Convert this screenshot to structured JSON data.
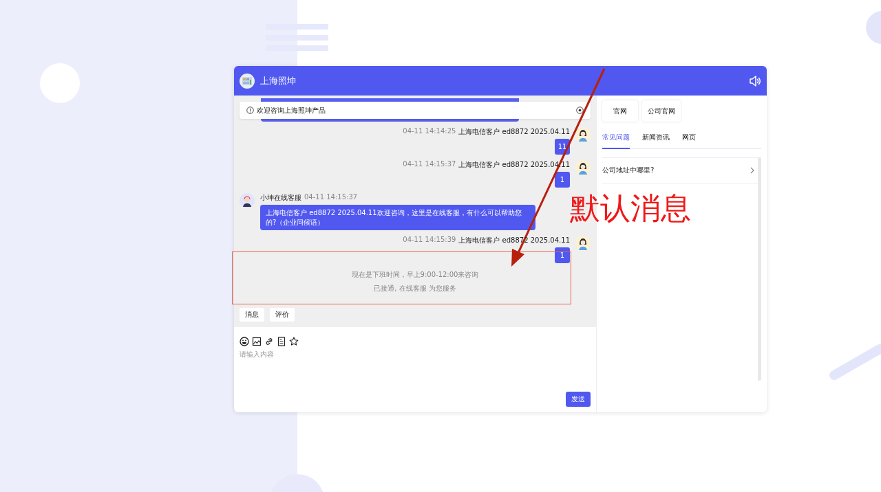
{
  "header": {
    "title": "上海照坤"
  },
  "notice": {
    "text": "欢迎咨询上海照坤产品"
  },
  "messages": [
    {
      "kind": "user",
      "time": "04-11 14:14:25",
      "sender": "上海电信客户 ed8872 2025.04.11",
      "text": "11"
    },
    {
      "kind": "user",
      "time": "04-11 14:15:37",
      "sender": "上海电信客户 ed8872 2025.04.11",
      "text": "1"
    },
    {
      "kind": "agent",
      "sender": "小坤在线客服",
      "time": "04-11 14:15:37",
      "text": "上海电信客户 ed8872 2025.04.11欢迎咨询，这里是在线客服，有什么可以帮助您的?（企业问候语）"
    },
    {
      "kind": "user",
      "time": "04-11 14:15:39",
      "sender": "上海电信客户 ed8872 2025.04.11",
      "text": "1"
    }
  ],
  "system_notes": [
    "现在是下班时间，早上9:00-12:00来咨询",
    "已接通, 在线客服 为您服务"
  ],
  "quick_buttons": [
    "消息",
    "评价"
  ],
  "composer": {
    "placeholder": "请输入内容",
    "send": "发送"
  },
  "side": {
    "links": [
      "官网",
      "公司官网"
    ],
    "tabs": [
      {
        "label": "常见问题",
        "selected": true
      },
      {
        "label": "新闻资讯",
        "selected": false
      },
      {
        "label": "网页",
        "selected": false
      }
    ],
    "faq": [
      "公司地址中哪里?"
    ]
  },
  "annotation": {
    "label": "默认消息"
  }
}
